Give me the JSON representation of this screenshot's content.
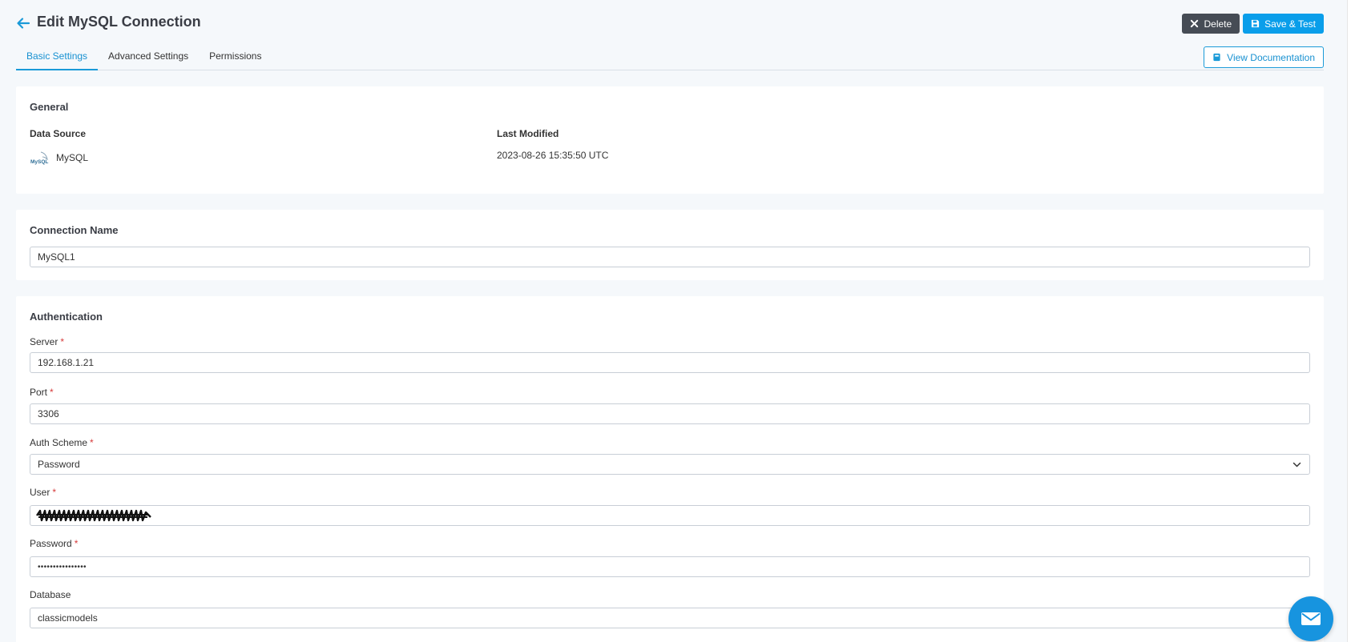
{
  "header": {
    "title": "Edit MySQL Connection",
    "delete_label": "Delete",
    "save_label": "Save & Test"
  },
  "tabs": [
    {
      "label": "Basic Settings",
      "active": true
    },
    {
      "label": "Advanced Settings",
      "active": false
    },
    {
      "label": "Permissions",
      "active": false
    }
  ],
  "docs_button": "View Documentation",
  "general": {
    "title": "General",
    "data_source_label": "Data Source",
    "data_source_value": "MySQL",
    "logo_text": "MySQL",
    "last_modified_label": "Last Modified",
    "last_modified_value": "2023-08-26 15:35:50 UTC"
  },
  "connection": {
    "title": "Connection Name",
    "value": "MySQL1"
  },
  "auth": {
    "title": "Authentication",
    "server_label": "Server",
    "server_value": "192.168.1.21",
    "port_label": "Port",
    "port_value": "3306",
    "scheme_label": "Auth Scheme",
    "scheme_value": "Password",
    "user_label": "User",
    "password_label": "Password",
    "password_value": "••••••••••••••••",
    "database_label": "Database",
    "database_value": "classicmodels",
    "required_mark": "*"
  },
  "colors": {
    "accent": "#0a9eea",
    "delete": "#464c55",
    "background": "#f5f8fb",
    "required": "#d63b3b"
  },
  "icons": [
    "back-arrow-icon",
    "close-icon",
    "save-icon",
    "book-icon",
    "chevron-down-icon",
    "mysql-logo-icon",
    "mail-icon"
  ]
}
